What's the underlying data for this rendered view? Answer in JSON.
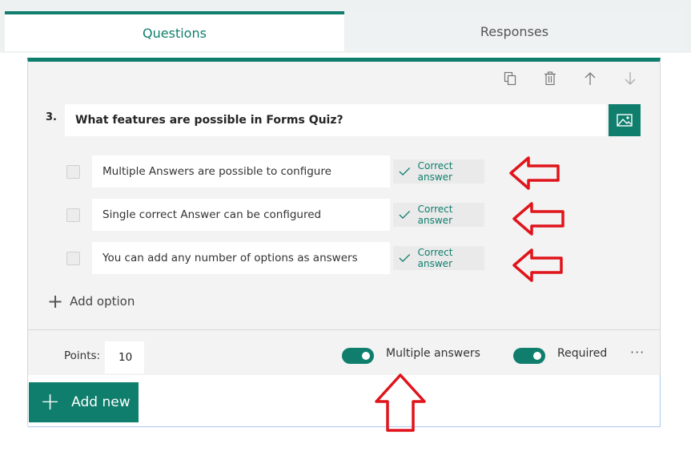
{
  "tabs": [
    {
      "label": "Questions",
      "active": true
    },
    {
      "label": "Responses",
      "active": false
    }
  ],
  "toolbar": {
    "icons": [
      "copy-icon",
      "delete-icon",
      "move-up-icon",
      "move-down-icon"
    ]
  },
  "question": {
    "number": "3.",
    "text": "What features are possible in Forms Quiz?"
  },
  "options": [
    {
      "text": "Multiple Answers are possible to configure",
      "correct_label": "Correct answer"
    },
    {
      "text": "Single correct Answer can be configured",
      "correct_label": "Correct answer"
    },
    {
      "text": "You can add any number of options as answers",
      "correct_label": "Correct answer"
    }
  ],
  "add_option_label": "Add option",
  "footer": {
    "points_label": "Points:",
    "points_value": "10",
    "multiple_answers_label": "Multiple answers",
    "multiple_answers_on": true,
    "required_label": "Required",
    "required_on": true,
    "more_label": "···"
  },
  "add_new_label": "Add new",
  "colors": {
    "accent": "#0f7e6d",
    "annotation": "#e0141b"
  }
}
